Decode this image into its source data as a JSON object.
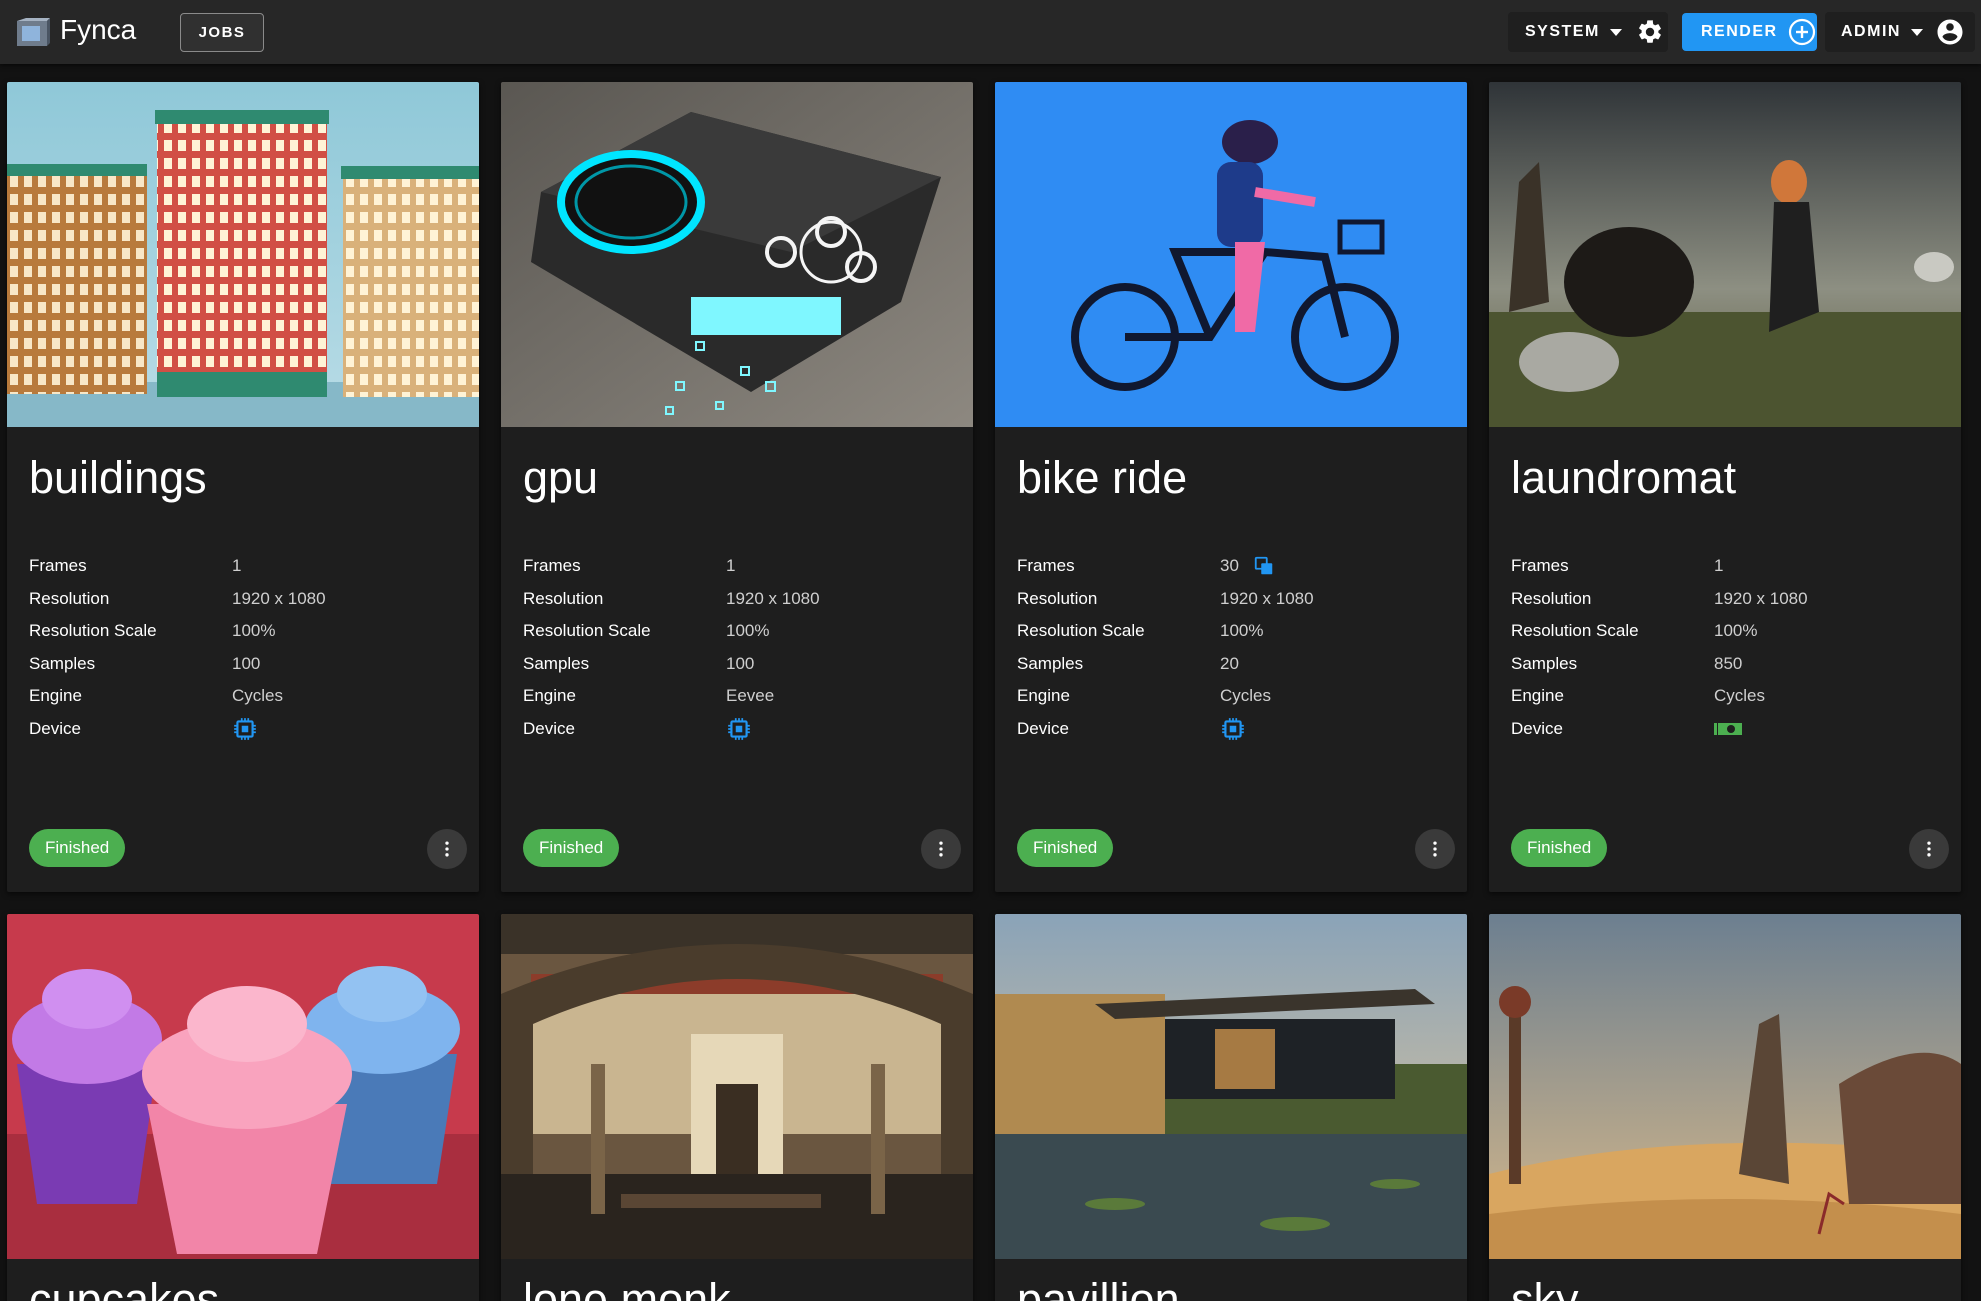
{
  "app": {
    "brand": "Fynca",
    "nav_jobs": "JOBS",
    "system_label": "SYSTEM",
    "render_label": "RENDER",
    "admin_label": "ADMIN",
    "accent_color": "#2196f3"
  },
  "labels": {
    "frames": "Frames",
    "resolution": "Resolution",
    "resolution_scale": "Resolution Scale",
    "samples": "Samples",
    "engine": "Engine",
    "device": "Device"
  },
  "jobs": [
    {
      "title": "buildings",
      "frames": "1",
      "resolution": "1920 x 1080",
      "scale": "100%",
      "samples": "100",
      "engine": "Cycles",
      "device_icon": "cpu-icon",
      "status": "Finished"
    },
    {
      "title": "gpu",
      "frames": "1",
      "resolution": "1920 x 1080",
      "scale": "100%",
      "samples": "100",
      "engine": "Eevee",
      "device_icon": "cpu-icon",
      "status": "Finished"
    },
    {
      "title": "bike ride",
      "frames": "30",
      "frames_icon": "copy-icon",
      "resolution": "1920 x 1080",
      "scale": "100%",
      "samples": "20",
      "engine": "Cycles",
      "device_icon": "cpu-icon",
      "status": "Finished"
    },
    {
      "title": "laundromat",
      "frames": "1",
      "resolution": "1920 x 1080",
      "scale": "100%",
      "samples": "850",
      "engine": "Cycles",
      "device_icon": "gpu-card-icon",
      "status": "Finished"
    },
    {
      "title": "cupcakes"
    },
    {
      "title": "lone monk"
    },
    {
      "title": "pavillion"
    },
    {
      "title": "sky"
    }
  ],
  "status_color": "#4caf50"
}
